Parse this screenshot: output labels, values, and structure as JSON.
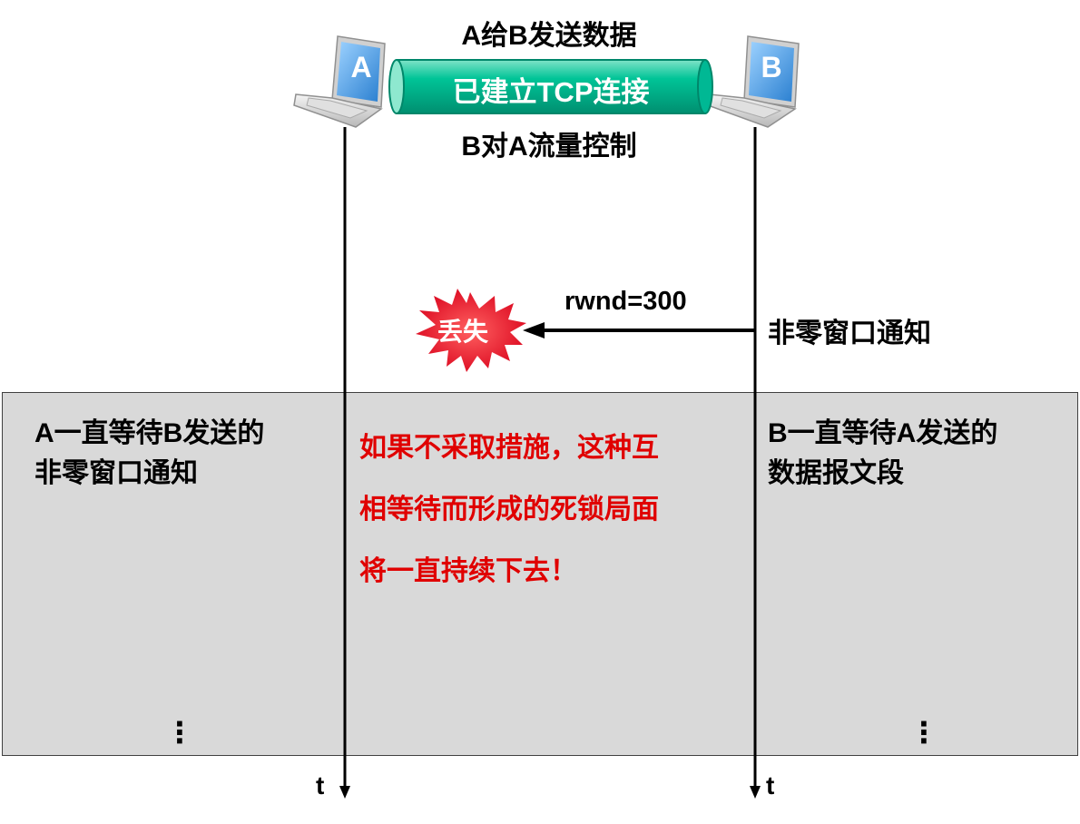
{
  "header": {
    "top_label": "A给B发送数据",
    "connection_label": "已建立TCP连接",
    "bottom_label": "B对A流量控制"
  },
  "hosts": {
    "a_label": "A",
    "b_label": "B"
  },
  "message": {
    "rwnd_label": "rwnd=300",
    "notice_label": "非零窗口通知",
    "lost_label": "丢失"
  },
  "boxes": {
    "left_lines": [
      "A一直等待B发送的",
      "非零窗口通知"
    ],
    "middle_lines": [
      "如果不采取措施，这种互",
      "相等待而形成的死锁局面",
      "将一直持续下去！"
    ],
    "right_lines": [
      "B一直等待A发送的",
      "数据报文段"
    ],
    "left_ellipsis": "⋮",
    "right_ellipsis": "⋮"
  },
  "timeline": {
    "a_time_label": "t",
    "b_time_label": "t"
  },
  "colors": {
    "pipe_green": "#00b894",
    "screen_blue": "#3a8fd8",
    "burst_red": "#e8001a",
    "warning_red": "#e00000",
    "box_gray": "#d9d9d9"
  }
}
